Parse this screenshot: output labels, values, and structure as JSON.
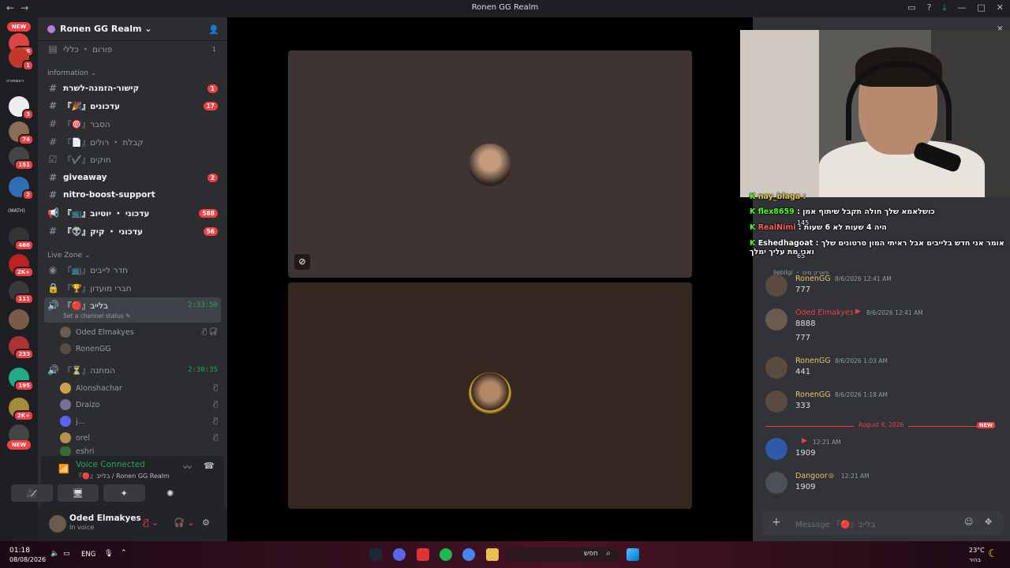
{
  "window": {
    "title": "Ronen GG Realm",
    "nav_back": "←",
    "nav_fwd": "→"
  },
  "servers": {
    "new_top": "NEW",
    "new_bottom": "NEW",
    "badges": [
      "196",
      "1",
      "3",
      "74",
      "151",
      "2",
      "466",
      "2K+",
      "111",
      "233",
      "195",
      "2K+"
    ],
    "label_ronenspora": "רונספורה",
    "label_math": "(MATH)"
  },
  "guild": {
    "name": "Ronen GG Realm",
    "chevron": "⌄"
  },
  "channels": {
    "forum": {
      "label": "פורום ・ כללי",
      "count": "1"
    },
    "cat_info": "information ⌄",
    "items": [
      {
        "label": "קישור-הזמנה-לשרת",
        "badge": "1",
        "unread": true
      },
      {
        "label": "『🎉』עדכונים",
        "badge": "17",
        "unread": true
      },
      {
        "label": "『🎯』הסבר",
        "badge": "",
        "unread": false
      },
      {
        "label": "『📄』קבלת ・ רולים",
        "badge": "",
        "unread": false
      },
      {
        "label": "『✔️』חוקים",
        "badge": "",
        "unread": false
      },
      {
        "label": "giveaway",
        "badge": "2",
        "unread": true
      },
      {
        "label": "nitro-boost-support",
        "badge": "",
        "unread": true
      },
      {
        "label": "『📺』עדכוני ・ יוטיוב",
        "badge": "588",
        "unread": true
      },
      {
        "label": "『👽』עדכוני ・ קיק",
        "badge": "56",
        "unread": true
      }
    ],
    "cat_live": "Live Zone ⌄",
    "live": [
      {
        "label": "『📺』חדר לייבים",
        "time": ""
      },
      {
        "label": "『🏆』חברי מועדון",
        "time": ""
      },
      {
        "label": "『🔴』בלייב",
        "time": "2:33:50"
      }
    ],
    "set_status": "Set a channel status ✎",
    "live_members": [
      "Oded Elmakyes",
      "RonenGG"
    ],
    "waiting": {
      "label": "『⏳』המתנה",
      "time": "2:30:35"
    },
    "waiting_members": [
      "Alonshachar",
      "Draizo",
      "j...",
      "orel",
      "eshri"
    ]
  },
  "voice": {
    "status": "Voice Connected",
    "sub": "『🔴』בלייב / Ronen GG Realm"
  },
  "user": {
    "name": "Oded Elmakyes",
    "status": "In voice"
  },
  "overlay": [
    {
      "user": "nay_blaga",
      "text": ":"
    },
    {
      "user": "flex8659",
      "text": ": כושלאמא שלך חולה תקבל שיתוף אמן"
    },
    {
      "user": "RealNimi",
      "text": ": היה 4 שעות לא 6 שעות"
    },
    {
      "user": "Eshedhagoat",
      "text": ": אומר אני חדש בלייבים אבל ראיתי המון סרטונים שלך ואני מת עליך ימלך"
    },
    {
      "user": "145",
      "text": ""
    },
    {
      "user": "65",
      "text": ""
    }
  ],
  "messages": [
    {
      "name": "RonenGG",
      "time": "8/6/2026 12:41 AM",
      "lines": [
        "777"
      ],
      "color": "#e9c46a"
    },
    {
      "name": "Oded Elmakyes",
      "time": "8/6/2026 12:41 AM",
      "lines": [
        "8888",
        "777"
      ],
      "color": "#f23f43"
    },
    {
      "name": "RonenGG",
      "time": "8/6/2026 1:03 AM",
      "lines": [
        "441"
      ],
      "color": "#e9c46a"
    },
    {
      "name": "RonenGG",
      "time": "8/6/2026 1:18 AM",
      "lines": [
        "333"
      ],
      "color": "#e9c46a"
    },
    {
      "name": "",
      "time": "12:21 AM",
      "lines": [
        "1909"
      ],
      "color": "#dbdee1"
    },
    {
      "name": "Dangoor",
      "time": "12:21 AM",
      "lines": [
        "1909"
      ],
      "color": "#e9c46a"
    }
  ],
  "reply_hint": "liebilgi ・ פארק מים",
  "divider": {
    "date": "August 8, 2026",
    "new": "NEW"
  },
  "input": {
    "placeholder": "Message 『🔴』בלייב"
  },
  "taskbar": {
    "time": "01:18",
    "date": "08/08/2026",
    "lang": "ENG",
    "search": "חפש",
    "temp": "23°C",
    "weather": "בהיר"
  }
}
